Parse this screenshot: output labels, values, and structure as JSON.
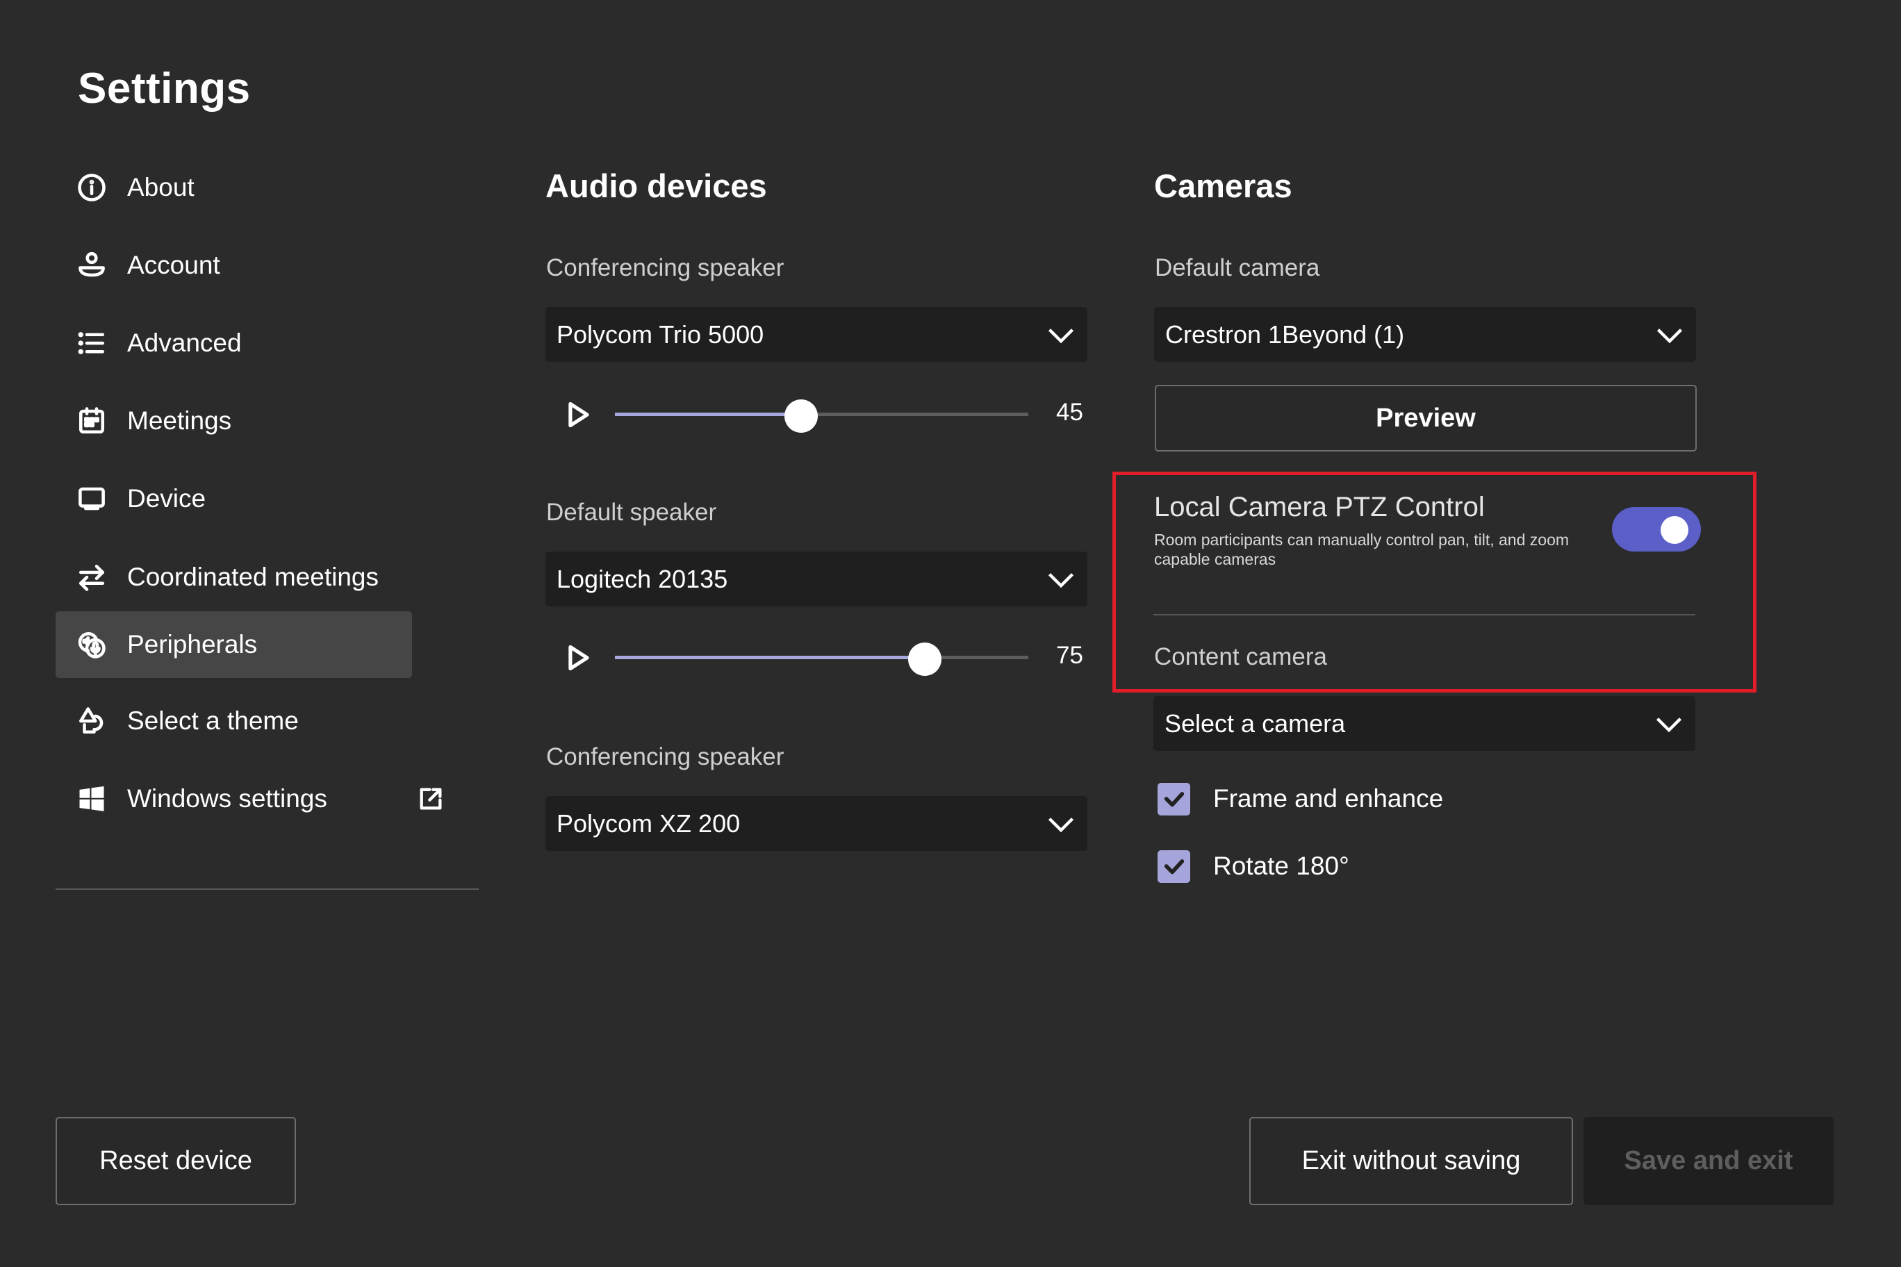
{
  "page": {
    "title": "Settings"
  },
  "sidebar": {
    "items": [
      {
        "label": "About",
        "icon": "info-icon",
        "selected": false
      },
      {
        "label": "Account",
        "icon": "person-icon",
        "selected": false
      },
      {
        "label": "Advanced",
        "icon": "list-icon",
        "selected": false
      },
      {
        "label": "Meetings",
        "icon": "calendar-icon",
        "selected": false
      },
      {
        "label": "Device",
        "icon": "monitor-icon",
        "selected": false
      },
      {
        "label": "Coordinated meetings",
        "icon": "arrows-swap-icon",
        "selected": false
      },
      {
        "label": "Peripherals",
        "icon": "peripherals-icon",
        "selected": true
      },
      {
        "label": "Select a theme",
        "icon": "shapes-icon",
        "selected": false
      },
      {
        "label": "Windows settings",
        "icon": "windows-logo-icon",
        "selected": false,
        "external": true
      }
    ]
  },
  "audio": {
    "heading": "Audio devices",
    "groups": [
      {
        "label": "Conferencing speaker",
        "selected": "Polycom Trio 5000",
        "volume": 45
      },
      {
        "label": "Default speaker",
        "selected": "Logitech 20135",
        "volume": 75
      },
      {
        "label": "Conferencing speaker",
        "selected": "Polycom XZ 200"
      }
    ]
  },
  "cameras": {
    "heading": "Cameras",
    "default_camera": {
      "label": "Default camera",
      "selected": "Crestron 1Beyond (1)"
    },
    "preview_label": "Preview",
    "ptz": {
      "title": "Local Camera PTZ Control",
      "description": "Room participants can manually control pan, tilt, and zoom capable cameras",
      "enabled": true
    },
    "content_camera": {
      "label": "Content camera",
      "selected": "Select a camera"
    },
    "options": [
      {
        "label": "Frame and enhance",
        "checked": true
      },
      {
        "label": "Rotate 180°",
        "checked": true
      }
    ]
  },
  "footer": {
    "reset_label": "Reset device",
    "exit_label": "Exit without saving",
    "save_label": "Save and exit"
  },
  "colors": {
    "background": "#2b2b2b",
    "accent": "#5b5fc7",
    "accent_light": "#a6a7dc",
    "selected_nav": "#464646",
    "highlight_box": "#e11d2a"
  }
}
